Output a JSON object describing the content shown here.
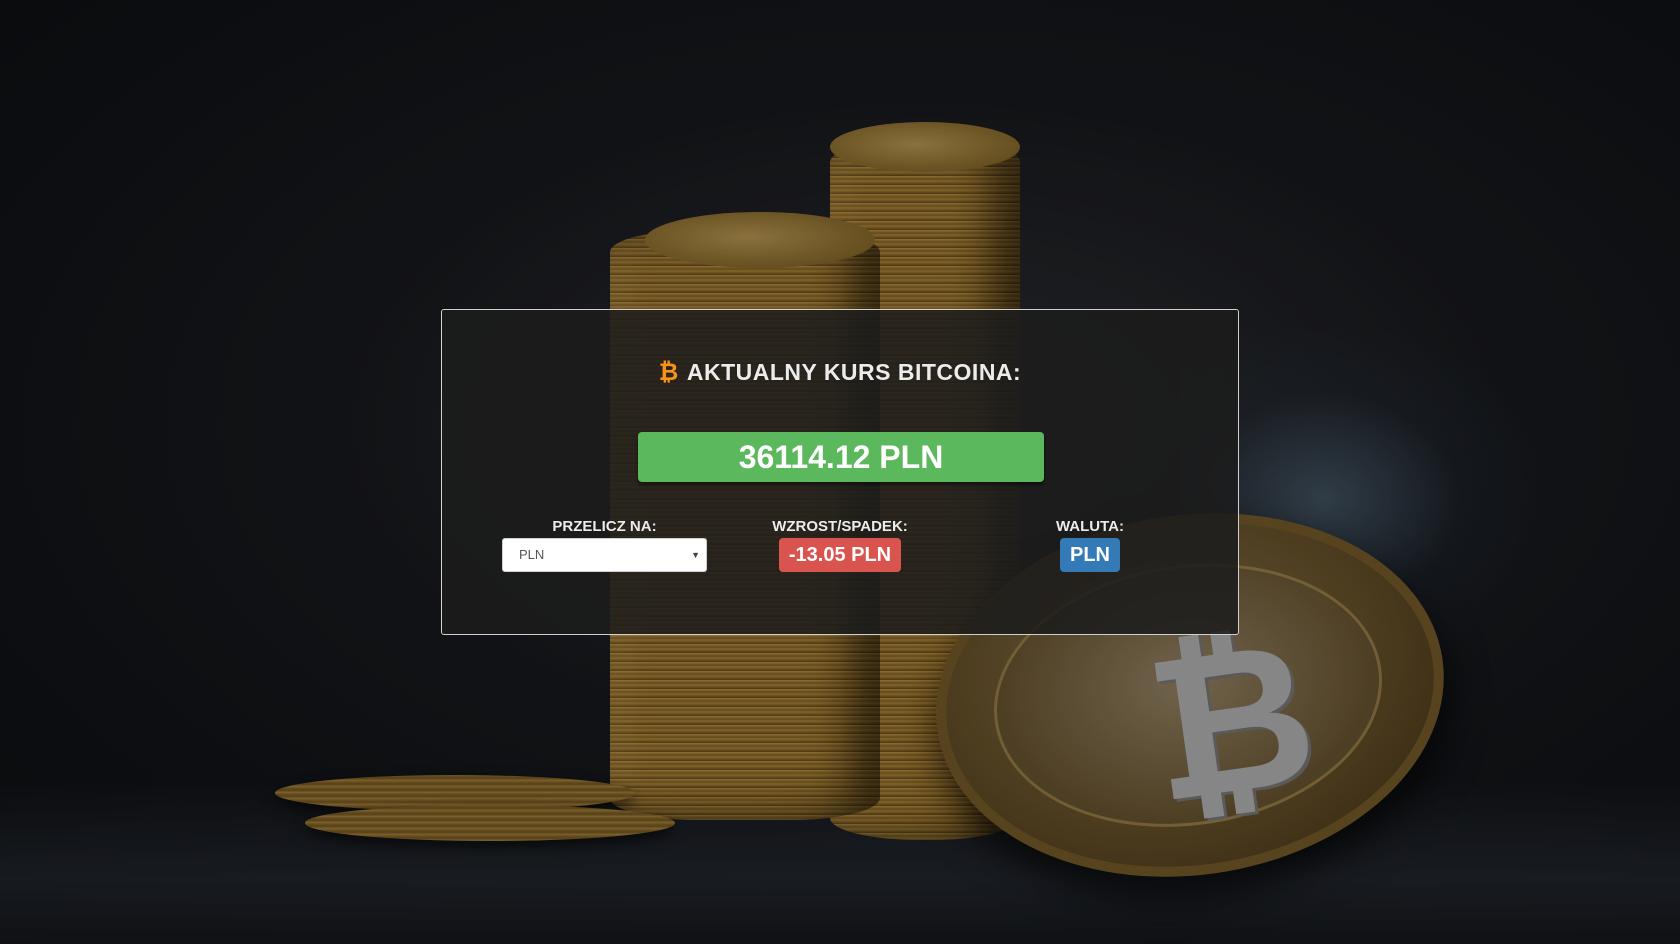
{
  "header": {
    "icon": "bitcoin-icon",
    "title": "AKTUALNY KURS BITCOINA:"
  },
  "price": {
    "value": "36114.12 PLN",
    "color": "#5cb85c"
  },
  "convert": {
    "label": "PRZELICZ NA:",
    "selected": "PLN"
  },
  "change": {
    "label": "WZROST/SPADEK:",
    "value": "-13.05 PLN",
    "color": "#d9534f"
  },
  "currency": {
    "label": "WALUTA:",
    "value": "PLN",
    "color": "#337ab7"
  }
}
